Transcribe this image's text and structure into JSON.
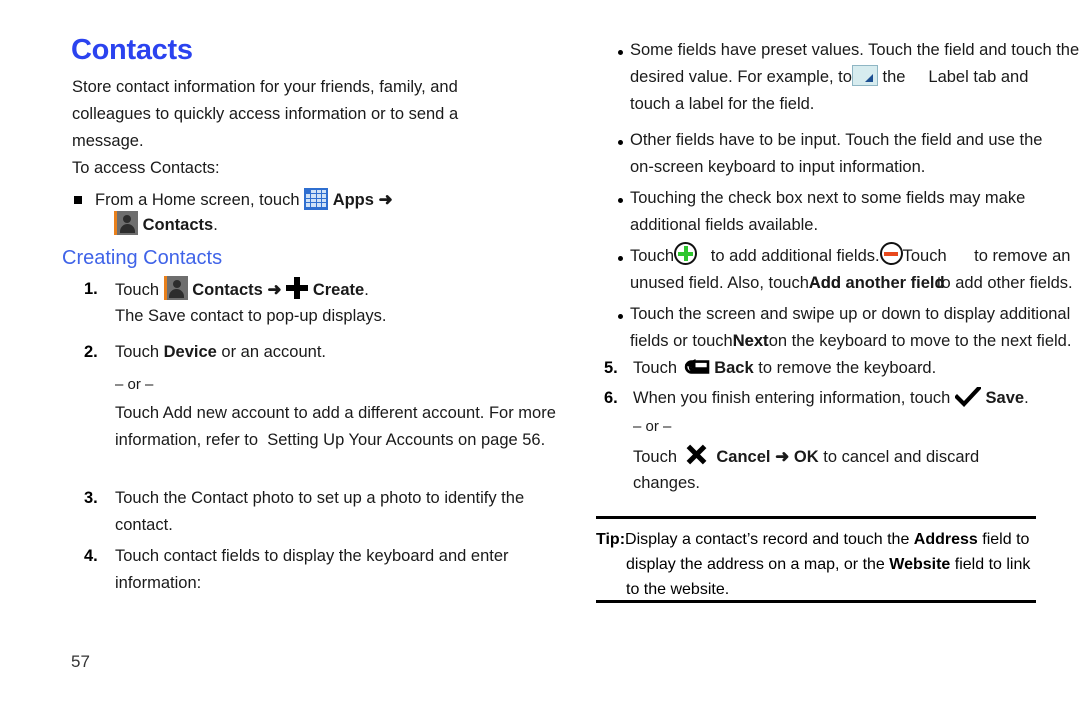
{
  "document": {
    "page_number": "57",
    "heading": "Contacts",
    "heading_color": "#2b43ef",
    "subheading": "Creating Contacts",
    "subheading_color": "#3f63e8"
  },
  "left_column": {
    "intro": "Store contact information for your friends, family, and colleagues to quickly access information or to send a message.",
    "access_label": "To access Contacts:",
    "access_bullet": {
      "pre": "From a Home screen, touch",
      "apps_label": "Apps",
      "arrow": "➜",
      "contacts_label": "Contacts",
      "period": "."
    },
    "steps": [
      {
        "number": "1.",
        "touch": "Touch",
        "contacts_label": "Contacts",
        "arrow": "➜",
        "create_label": "Create",
        "period": ".",
        "sub": "The Save contact to pop-up displays."
      },
      {
        "number": "2.",
        "pre": "Touch ",
        "bold": "Device",
        "post": " or an account.",
        "or": "– or –",
        "alt": "Touch Add new account to add a different account. For more information, refer to  Setting Up Your Accounts on page 56."
      },
      {
        "number": "3.",
        "text": "Touch the Contact photo to set up a photo to identify the contact."
      },
      {
        "number": "4.",
        "text": "Touch contact fields to display the keyboard and enter information:"
      }
    ]
  },
  "right_column": {
    "bullets": [
      {
        "line1": "Some fields have preset values. Touch the field and touch the",
        "line2_pre": "desired value. For example, to",
        "line2_mid": "the",
        "line2_post": "Label tab and",
        "line3": "touch a label for the field."
      },
      {
        "line1": "Other fields have to be input. Touch the field and use the",
        "line2": "on-screen keyboard to input information."
      },
      {
        "line1": "Touching the check box next to some fields may make",
        "line2": "additional fields available."
      },
      {
        "line1_a": "Touch",
        "line1_b": "to add additional fields.",
        "line1_c": "Touch",
        "line1_d": "to remove an",
        "line2_a": "unused field. Also, touch",
        "line2_overlap_1": "Add",
        "line2_overlap_2": "Add another field",
        "line2_b": "to add other fields."
      },
      {
        "line1": "Touch the screen and swipe up or down to display additional",
        "line2_a": "fields or touch",
        "line2_overlap_1": "Next",
        "line2_overlap_2": "Next",
        "line2_b": "on the keyboard to move to the next field."
      }
    ],
    "steps": [
      {
        "number": "5.",
        "pre": "Touch",
        "bold": "Back",
        "post": "to remove the keyboard."
      },
      {
        "number": "6.",
        "pre": "When you finish entering information, touch",
        "bold": "Save",
        "post": ".",
        "or": "– or –",
        "alt_pre": "Touch",
        "alt_bold1": "Cancel",
        "alt_arrow": "➜",
        "alt_bold2": "OK",
        "alt_post": "to cancel and discard",
        "alt_line2": "changes."
      }
    ],
    "tip": {
      "label": "Tip:",
      "line1_pre": "Display a contact’s record and touch the ",
      "line1_bold": "Address",
      "line1_post": " field to",
      "line2_pre": "display the address on a map, or the ",
      "line2_bold": "Website",
      "line2_post": " field to link",
      "line3": "to the website."
    }
  },
  "icons": {
    "apps": "apps-grid-icon",
    "contacts": "contacts-person-icon",
    "create": "plus-icon",
    "dropdown": "dropdown-tab-icon",
    "add_field": "circled-plus-icon",
    "remove_field": "circled-minus-icon",
    "back": "back-arrow-icon",
    "save": "checkmark-icon",
    "cancel": "x-icon"
  },
  "colors": {
    "heading_blue": "#2b43ef",
    "subheading_blue": "#3f63e8",
    "apps_icon_blue": "#2f6fd0",
    "contacts_icon_gray": "#6e6e6e",
    "contacts_icon_accent": "#e8801c",
    "plus_green": "#2ec62e",
    "minus_orange": "#e8481c",
    "dropdown_fill": "#d7ecef",
    "dropdown_triangle": "#1d4f91"
  }
}
